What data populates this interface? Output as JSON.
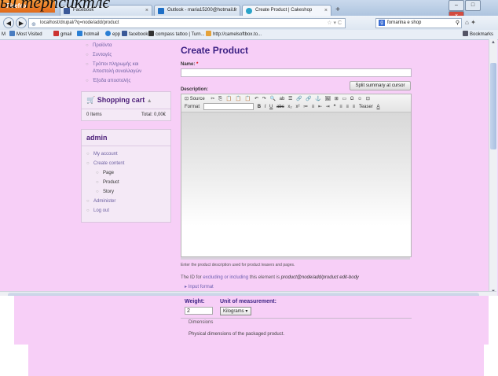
{
  "caption_text": "ьи терпсиктлє",
  "browser": {
    "firefox_label": "Firefox",
    "tabs": [
      {
        "label": "Facebook",
        "color": "#3b5998"
      },
      {
        "label": "Outlook - maria15200@hotmail.fr",
        "color": "#1f6fc5"
      },
      {
        "label": "Create Product | Cakeshop",
        "color": "#2aa3c9"
      }
    ],
    "new_tab": "+",
    "url": "localhost/drupal/?q=node/add/product",
    "search_text": "fornarina e shop",
    "bookmarks_left_label": "M",
    "bookmarks": [
      {
        "label": "Most Visited",
        "color": "#4a7cc0"
      },
      {
        "label": "gmail",
        "color": "#c33"
      },
      {
        "label": "hotmail",
        "color": "#2a7fd4"
      },
      {
        "label": "epp",
        "color": "#2a7fd4"
      },
      {
        "label": "facebook",
        "color": "#3b5998"
      },
      {
        "label": "compass tattoo | Turn...",
        "color": "#333"
      },
      {
        "label": "http://camelsoftbox.to...",
        "color": "#e5a23a"
      }
    ],
    "bookmarks_right": "Bookmarks"
  },
  "sidebar": {
    "top_menu": [
      "Προϊόντα",
      "Συνταγές",
      "Τρόποι πληρωμής και Αποστολή συναλλαγών",
      "Έξοδα αποστολής"
    ],
    "cart": {
      "title": "Shopping cart",
      "items": "0 Items",
      "total": "Total: 0,00€"
    },
    "admin": {
      "title": "admin",
      "items": [
        {
          "label": "My account",
          "level": 0
        },
        {
          "label": "Create content",
          "level": 0
        },
        {
          "label": "Page",
          "level": 1
        },
        {
          "label": "Product",
          "level": 1
        },
        {
          "label": "Story",
          "level": 1
        },
        {
          "label": "Administer",
          "level": 0
        },
        {
          "label": "Log out",
          "level": 0
        }
      ]
    }
  },
  "main": {
    "title": "Create Product",
    "name_label": "Name:",
    "required_mark": "*",
    "split_button": "Split summary at cursor",
    "description_label": "Description:",
    "toolbar_row1": [
      "Source",
      "✂",
      "⎘",
      "📋",
      "📋",
      "📋",
      "↶",
      "↷",
      "🔍",
      "ab",
      "☰",
      "🔗",
      "🔗",
      "⚓",
      "🖼",
      "⊞",
      "▭",
      "Ω",
      "☺",
      "⊡"
    ],
    "toolbar_row2_format": "Format",
    "toolbar_row2": [
      "B",
      "I",
      "U",
      "abc",
      "x₂",
      "x²",
      "≔",
      "≡",
      "⇤",
      "⇥",
      "❝",
      "≡",
      "≡",
      "≡",
      "Teaser",
      "A"
    ],
    "help_text": "Enter the product description used for product teasers and pages.",
    "id_text_prefix": "The ID for",
    "id_excluding": "excluding or including",
    "id_text_mid": "this element is",
    "id_value": "product@node/add/product edit-body",
    "input_format": "Input format",
    "weight_label": "Weight:",
    "weight_value": "2",
    "unit_label": "Unit of measurement:",
    "unit_value": "Kilograms",
    "dimensions_legend": "Dimensions",
    "dimensions_desc": "Physical dimensions of the packaged product."
  }
}
